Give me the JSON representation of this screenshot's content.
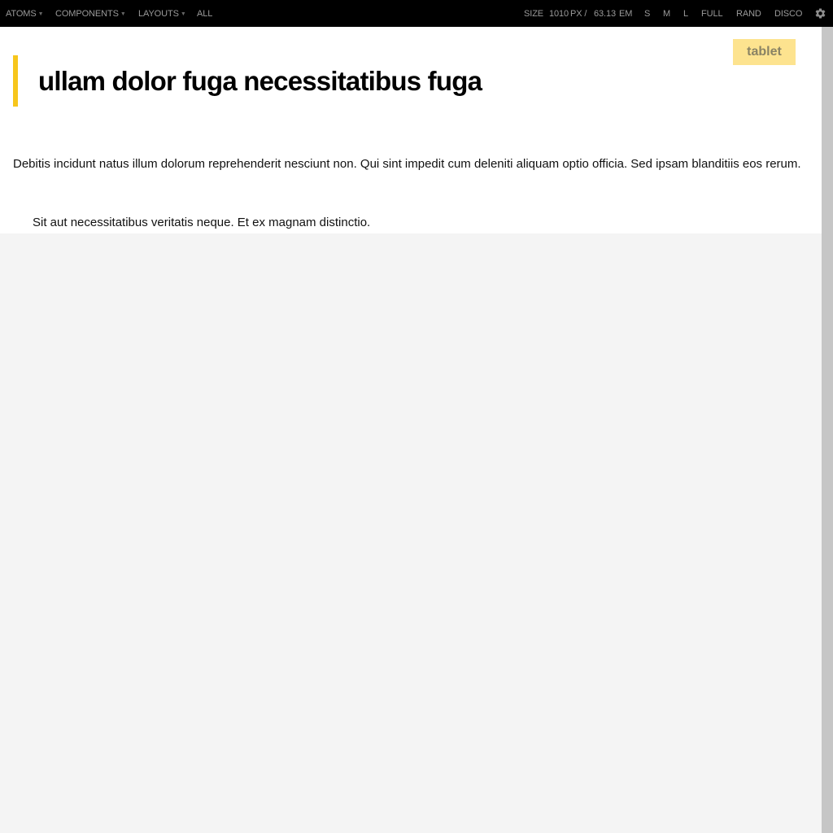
{
  "toolbar": {
    "nav": [
      {
        "label": "ATOMS",
        "has_dropdown": true
      },
      {
        "label": "COMPONENTS",
        "has_dropdown": true
      },
      {
        "label": "LAYOUTS",
        "has_dropdown": true
      },
      {
        "label": "ALL",
        "has_dropdown": false
      }
    ],
    "size_label": "SIZE",
    "size_px": "1010",
    "px_unit": "PX /",
    "size_em": "63.13",
    "em_unit": "EM",
    "sizes": {
      "s": "S",
      "m": "M",
      "l": "L",
      "full": "FULL",
      "rand": "RAND",
      "disco": "DISCO"
    },
    "settings_icon": "gear-icon",
    "caret_icon": "caret-down-icon"
  },
  "content": {
    "badge": "tablet",
    "title": "ullam dolor fuga necessitatibus fuga",
    "paragraph": "Debitis incidunt natus illum dolorum reprehenderit nesciunt non. Qui sint impedit cum deleniti aliquam optio officia. Sed ipsam blanditiis eos rerum.",
    "blockquote": "Sit aut necessitatibus veritatis neque. Et ex magnam distinctio."
  },
  "colors": {
    "toolbar_bg": "#000000",
    "toolbar_text": "#9a9a9a",
    "accent_bar": "#f7c61c",
    "badge_bg": "#fde38f",
    "viewport_bg": "#f4f4f4",
    "scrollbar": "#c6c6c6"
  }
}
